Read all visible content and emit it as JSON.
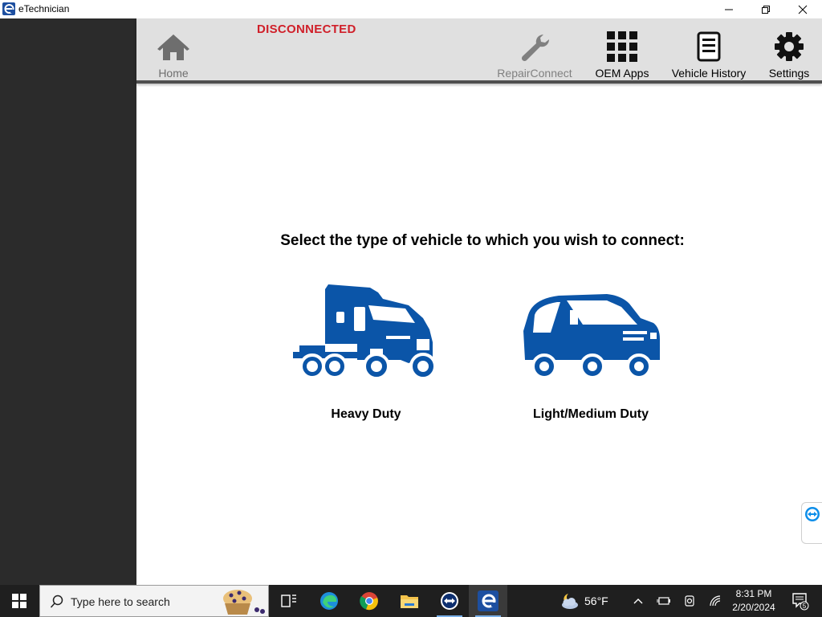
{
  "window": {
    "title": "eTechnician",
    "controls": {
      "minimize": "—",
      "restore": "❐",
      "close": "✕"
    }
  },
  "toolbar": {
    "status": "DISCONNECTED",
    "items": [
      {
        "label": "Home",
        "icon": "home-icon"
      },
      {
        "label": "RepairConnect",
        "icon": "wrench-icon"
      },
      {
        "label": "OEM Apps",
        "icon": "grid-icon"
      },
      {
        "label": "Vehicle History",
        "icon": "document-icon"
      },
      {
        "label": "Settings",
        "icon": "gear-icon"
      }
    ]
  },
  "main": {
    "prompt": "Select the type of vehicle to which you wish to connect:",
    "vehicles": [
      {
        "label": "Heavy Duty",
        "icon": "semi-truck-icon"
      },
      {
        "label": "Light/Medium Duty",
        "icon": "van-icon"
      }
    ]
  },
  "taskbar": {
    "search_placeholder": "Type here to search",
    "weather": "56°F",
    "time": "8:31 PM",
    "date": "2/20/2024",
    "notification_count": "5"
  },
  "colors": {
    "status_red": "#d0202a",
    "vehicle_blue": "#0b55a8",
    "sidebar": "#2b2b2b",
    "toolbar": "#e0e0e0"
  }
}
